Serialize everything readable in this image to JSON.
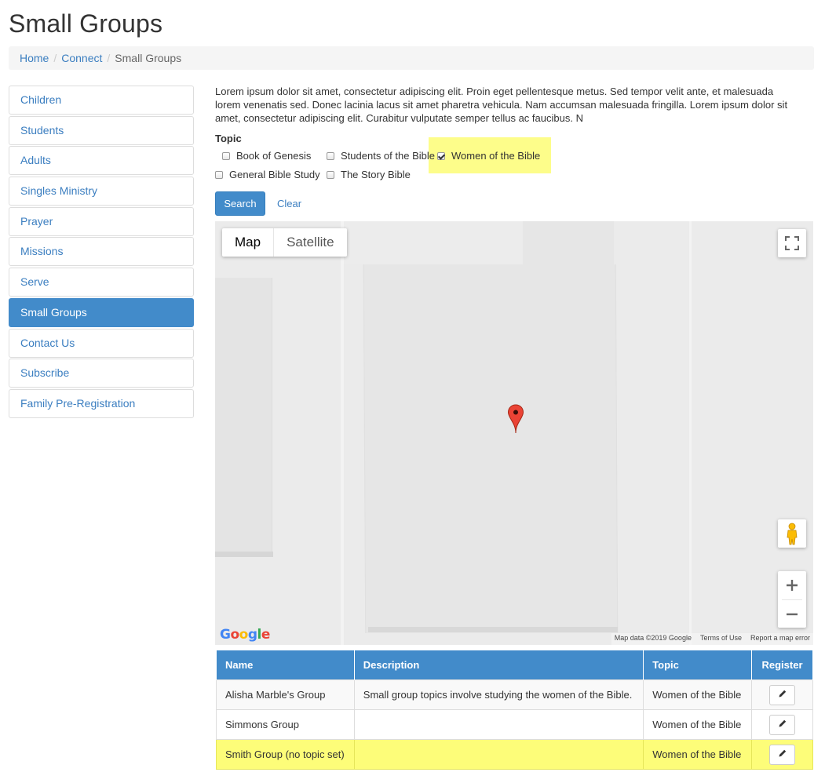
{
  "page": {
    "title": "Small Groups"
  },
  "breadcrumb": {
    "items": [
      "Home",
      "Connect"
    ],
    "current": "Small Groups"
  },
  "sidebar": {
    "items": [
      {
        "label": "Children"
      },
      {
        "label": "Students"
      },
      {
        "label": "Adults"
      },
      {
        "label": "Singles Ministry"
      },
      {
        "label": "Prayer"
      },
      {
        "label": "Missions"
      },
      {
        "label": "Serve"
      },
      {
        "label": "Small Groups",
        "active": true
      },
      {
        "label": "Contact Us"
      },
      {
        "label": "Subscribe"
      },
      {
        "label": "Family Pre-Registration"
      }
    ]
  },
  "intro": "Lorem ipsum dolor sit amet, consectetur adipiscing elit. Proin eget pellentesque metus. Sed tempor velit ante, et malesuada lorem venenatis sed. Donec lacinia lacus sit amet pharetra vehicula. Nam accumsan malesuada fringilla. Lorem ipsum dolor sit amet, consectetur adipiscing elit. Curabitur vulputate semper tellus ac faucibus. N",
  "filter": {
    "label": "Topic",
    "options": [
      {
        "label": "Book of Genesis",
        "checked": false
      },
      {
        "label": "Students of the Bible",
        "checked": false
      },
      {
        "label": "Women of the Bible",
        "checked": true
      },
      {
        "label": "General Bible Study",
        "checked": false
      },
      {
        "label": "The Story Bible",
        "checked": false
      }
    ],
    "search_label": "Search",
    "clear_label": "Clear"
  },
  "map": {
    "type_map": "Map",
    "type_satellite": "Satellite",
    "logo_text": "Google",
    "attribution": "Map data ©2019 Google",
    "terms": "Terms of Use",
    "report": "Report a map error",
    "zoom_in": "+",
    "zoom_out": "−",
    "colors": {
      "marker": "#ea4335",
      "logo_blue": "#4285f4",
      "logo_red": "#ea4335",
      "logo_yellow": "#fbbc05",
      "logo_green": "#34a853"
    }
  },
  "table": {
    "headers": {
      "name": "Name",
      "description": "Description",
      "topic": "Topic",
      "register": "Register"
    },
    "rows": [
      {
        "name": "Alisha Marble's Group",
        "description": "Small group topics involve studying the women of the Bible.",
        "topic": "Women of the Bible"
      },
      {
        "name": "Simmons Group",
        "description": "",
        "topic": "Women of the Bible"
      },
      {
        "name": "Smith Group (no topic set)",
        "description": "",
        "topic": "Women of the Bible"
      }
    ]
  },
  "colors": {
    "primary": "#428bca",
    "link": "#3b7ec0",
    "highlight": "#fdfd79"
  }
}
